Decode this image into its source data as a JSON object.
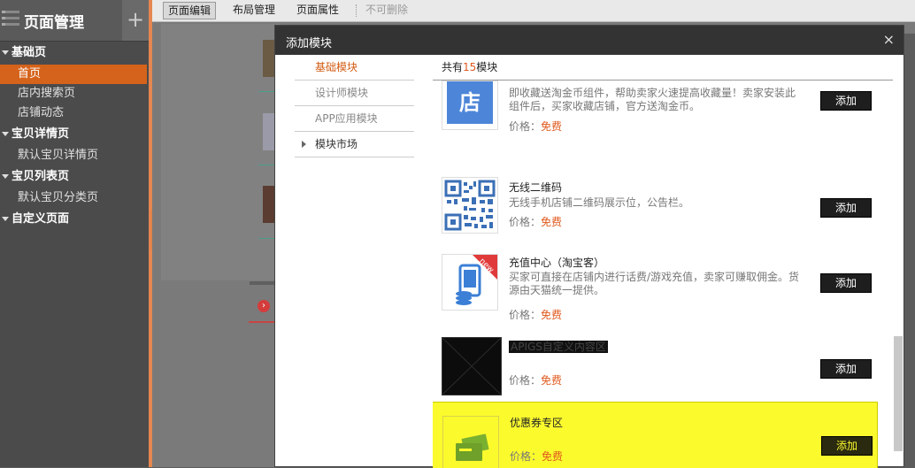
{
  "sidebar": {
    "title": "页面管理",
    "add_symbol": "+",
    "groups": [
      {
        "label": "基础页",
        "items": [
          "首页",
          "店内搜索页",
          "店铺动态"
        ]
      },
      {
        "label": "宝贝详情页",
        "items": [
          "默认宝贝详情页"
        ]
      },
      {
        "label": "宝贝列表页",
        "items": [
          "默认宝贝分类页"
        ]
      },
      {
        "label": "自定义页面",
        "items": []
      }
    ],
    "active_item": "首页"
  },
  "toolbar": {
    "page_edit": "页面编辑",
    "layout_manage": "布局管理",
    "page_props": "页面属性",
    "cannot_delete": "不可删除"
  },
  "modal": {
    "title": "添加模块",
    "close": "×",
    "nav": [
      "基础模块",
      "设计师模块",
      "APP应用模块",
      "模块市场"
    ],
    "count_prefix": "共有",
    "count": "15",
    "count_suffix": "模块",
    "price_label": "价格：",
    "add_label": "添加",
    "modules": [
      {
        "title": "",
        "desc": "即收藏送淘金币组件，帮助卖家火速提高收藏量！卖家安装此组件后，买家收藏店铺，官方送淘金币。",
        "price": "免费",
        "icon": "store-icon",
        "icon_text": "店"
      },
      {
        "title": "无线二维码",
        "desc": "无线手机店铺二维码展示位，公告栏。",
        "price": "免费",
        "icon": "qr-code-icon"
      },
      {
        "title": "充值中心（淘宝客）",
        "desc": "买家可直接在店铺内进行话费/游戏充值，卖家可赚取佣金。货源由天猫统一提供。",
        "price": "免费",
        "icon": "recharge-icon",
        "badge": "new"
      },
      {
        "title": "APIGS自定义内容区",
        "desc": "",
        "price": "免费",
        "icon": "placeholder-icon"
      },
      {
        "title": "优惠券专区",
        "desc": "",
        "price": "免费",
        "icon": "coupon-icon"
      }
    ]
  },
  "colors": {
    "accent": "#d5631b",
    "highlight": "#fbfa2d",
    "price": "#e05a1e"
  }
}
